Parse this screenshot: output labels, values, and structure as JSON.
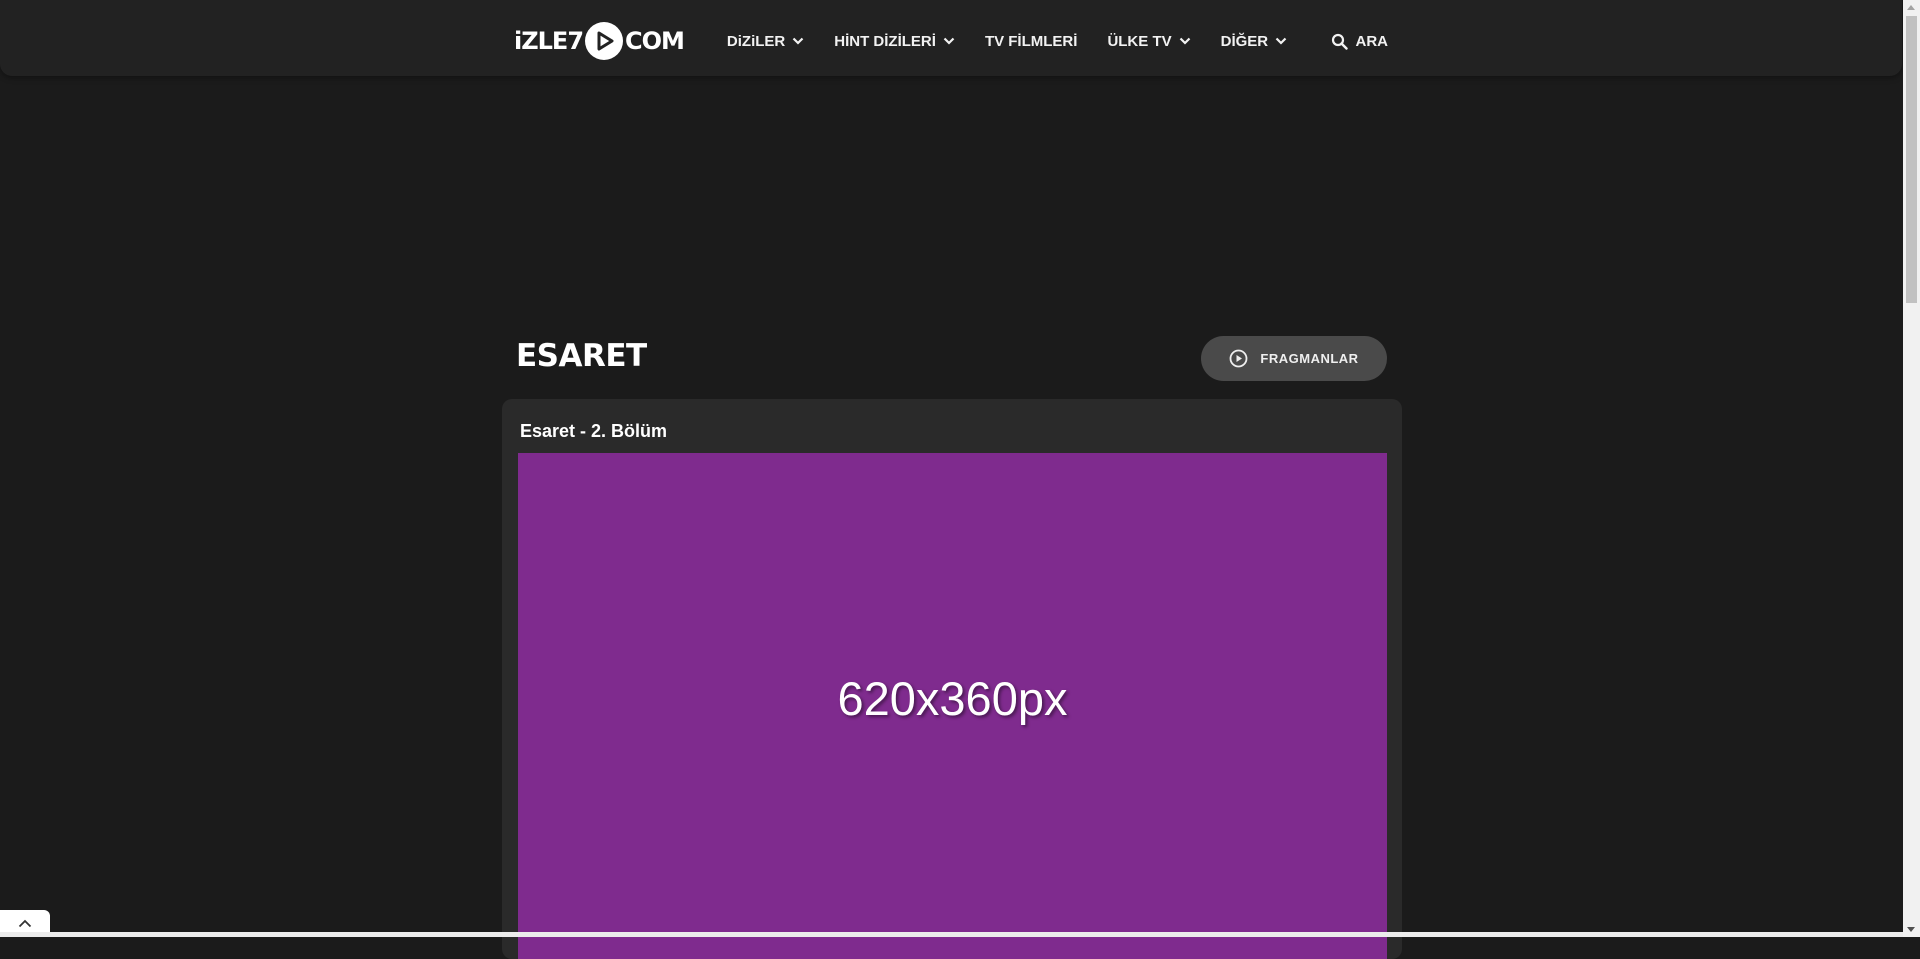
{
  "header": {
    "logo": {
      "left": "iZLE7",
      "right": "COM"
    },
    "nav": [
      {
        "label": "DiZiLER",
        "dropdown": true,
        "icon": "chevron-down-icon"
      },
      {
        "label": "HİNT DİZİLERİ",
        "dropdown": true,
        "icon": "chevron-down-icon"
      },
      {
        "label": "TV FİLMLERİ",
        "dropdown": false
      },
      {
        "label": "ÜLKE TV",
        "dropdown": true,
        "icon": "chevron-down-icon"
      },
      {
        "label": "DİĞER",
        "dropdown": true,
        "icon": "chevron-down-icon"
      }
    ],
    "search": {
      "label": "ARA",
      "icon": "search-icon"
    }
  },
  "page": {
    "title": "ESARET",
    "trailer_button": {
      "label": "FRAGMANLAR",
      "icon": "play-circle-icon"
    }
  },
  "player": {
    "episode_title": "Esaret - 2. Bölüm",
    "placeholder_text": "620x360px",
    "placeholder_color": "#7f2b8e"
  },
  "colors": {
    "background": "#1b1b1b",
    "header": "#222222",
    "card": "#2a2a2a",
    "button": "#4a4a4a"
  }
}
